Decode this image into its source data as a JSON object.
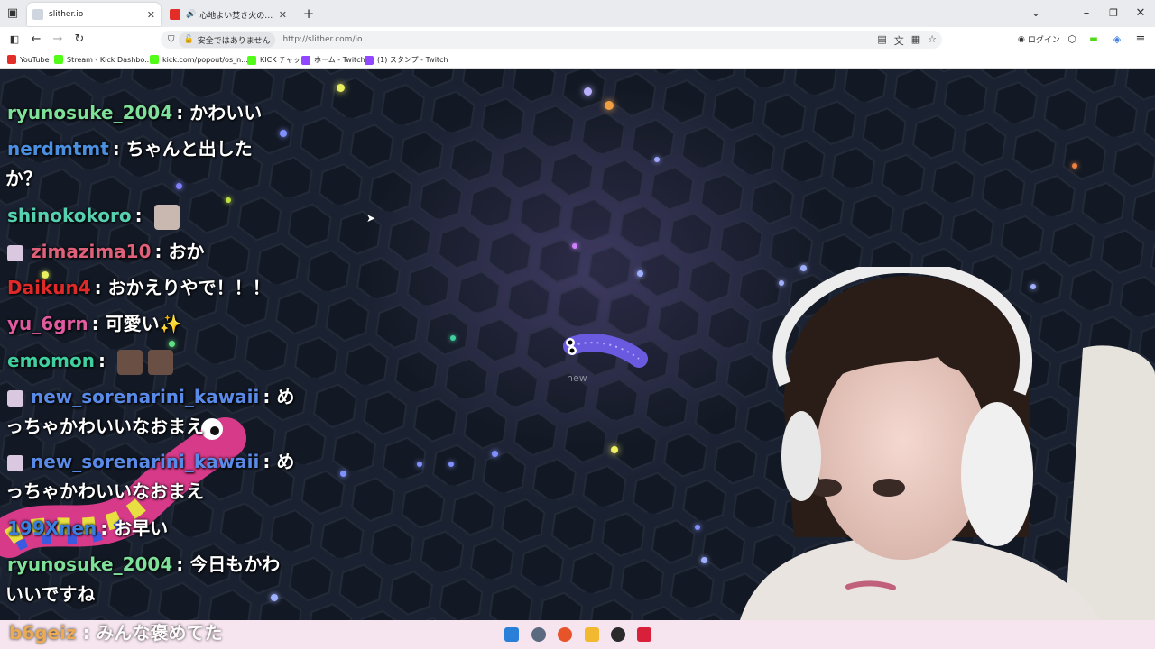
{
  "browser": {
    "tabs": [
      {
        "title": "slither.io",
        "active": true
      },
      {
        "title": "心地よい焚き火の音で眠る前",
        "active": false
      }
    ],
    "new_tab": "+",
    "address": {
      "security_label": "安全ではありません",
      "url": "http://slither.com/io"
    },
    "login_label": "ログイン",
    "bookmarks": [
      {
        "label": "YouTube",
        "color": "#e52d27"
      },
      {
        "label": "Stream - Kick Dashbo...",
        "color": "#53fc18"
      },
      {
        "label": "kick.com/popout/os_n...",
        "color": "#53fc18"
      },
      {
        "label": "KICK チャット",
        "color": "#53fc18"
      },
      {
        "label": "ホーム - Twitch",
        "color": "#9146ff"
      },
      {
        "label": "(1) スタンプ - Twitch",
        "color": "#9146ff"
      }
    ]
  },
  "game": {
    "player_name": "new"
  },
  "chat": {
    "messages": [
      {
        "user": "ryunosuke_2004",
        "color": "#7fe09a",
        "text": "かわいい"
      },
      {
        "user": "nerdmtmt",
        "color": "#4a8fe0",
        "text": "ちゃんと出した"
      },
      {
        "user": "",
        "color": "#ffffff",
        "text": "か？"
      },
      {
        "user": "shinokokoro",
        "color": "#56d0b0",
        "text": ""
      },
      {
        "user": "zimazima10",
        "color": "#e0607a",
        "text": "おか"
      },
      {
        "user": "Daikun4",
        "color": "#e02a2a",
        "text": "おかえりやで！！！"
      },
      {
        "user": "yu_6grn",
        "color": "#e05aa0",
        "text": "可愛い✨"
      },
      {
        "user": "emomon",
        "color": "#40d0a0",
        "text": ""
      },
      {
        "user": "new_sorenarini_kawaii",
        "color": "#5a8ae8",
        "text": "め"
      },
      {
        "user": "",
        "color": "#ffffff",
        "text": "っちゃかわいいなおまえ"
      },
      {
        "user": "new_sorenarini_kawaii",
        "color": "#5a8ae8",
        "text": "め"
      },
      {
        "user": "",
        "color": "#ffffff",
        "text": "っちゃかわいいなおまえ"
      },
      {
        "user": "199Xnen",
        "color": "#3a7ee0",
        "text": "お早い"
      },
      {
        "user": "ryunosuke_2004",
        "color": "#7fe09a",
        "text": "今日もかわ"
      },
      {
        "user": "",
        "color": "#ffffff",
        "text": "いいですね"
      }
    ],
    "separator": ":",
    "bottom_message": {
      "user": "b6geiz",
      "color": "#e8a23a",
      "text": "みんな褒めてた"
    }
  },
  "taskbar": {
    "icons": [
      {
        "name": "windows-start",
        "color": "#2a7fd8"
      },
      {
        "name": "settings",
        "color": "#5a6a80"
      },
      {
        "name": "firefox",
        "color": "#e8542a"
      },
      {
        "name": "file-explorer",
        "color": "#f2b830"
      },
      {
        "name": "obs",
        "color": "#2a2a2a"
      },
      {
        "name": "app",
        "color": "#d8203a"
      }
    ]
  }
}
